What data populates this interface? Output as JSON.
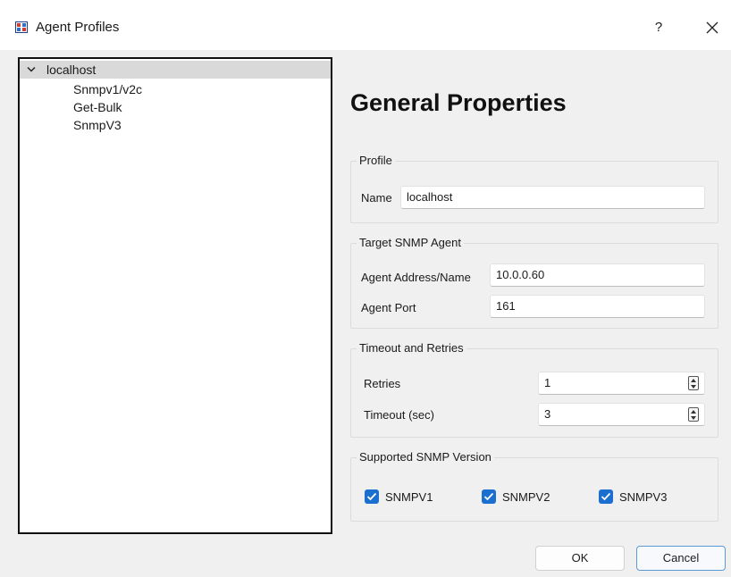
{
  "window": {
    "title": "Agent Profiles",
    "help_label": "?",
    "close_label": "✕"
  },
  "tree": {
    "root_label": "localhost",
    "children": [
      "Snmpv1/v2c",
      "Get-Bulk",
      "SnmpV3"
    ]
  },
  "heading": "General Properties",
  "profile": {
    "group_title": "Profile",
    "name_label": "Name",
    "name_value": "localhost"
  },
  "target": {
    "group_title": "Target SNMP Agent",
    "address_label": "Agent Address/Name",
    "address_value": "10.0.0.60",
    "port_label": "Agent Port",
    "port_value": "161"
  },
  "timeout": {
    "group_title": "Timeout and Retries",
    "retries_label": "Retries",
    "retries_value": "1",
    "timeout_label": "Timeout (sec)",
    "timeout_value": "3"
  },
  "versions": {
    "group_title": "Supported SNMP Version",
    "items": [
      {
        "label": "SNMPV1",
        "checked": true
      },
      {
        "label": "SNMPV2",
        "checked": true
      },
      {
        "label": "SNMPV3",
        "checked": true
      }
    ]
  },
  "buttons": {
    "ok": "OK",
    "cancel": "Cancel"
  },
  "colors": {
    "checkbox_accent": "#1b6fcf",
    "primary_border": "#5a9bd5",
    "tree_selection": "#d9d9d9"
  },
  "icons": {
    "app": "agent-profiles-app-icon",
    "expand": "chevron-down-icon",
    "check": "checkmark-icon",
    "spin": "spinner-arrows-icon"
  }
}
